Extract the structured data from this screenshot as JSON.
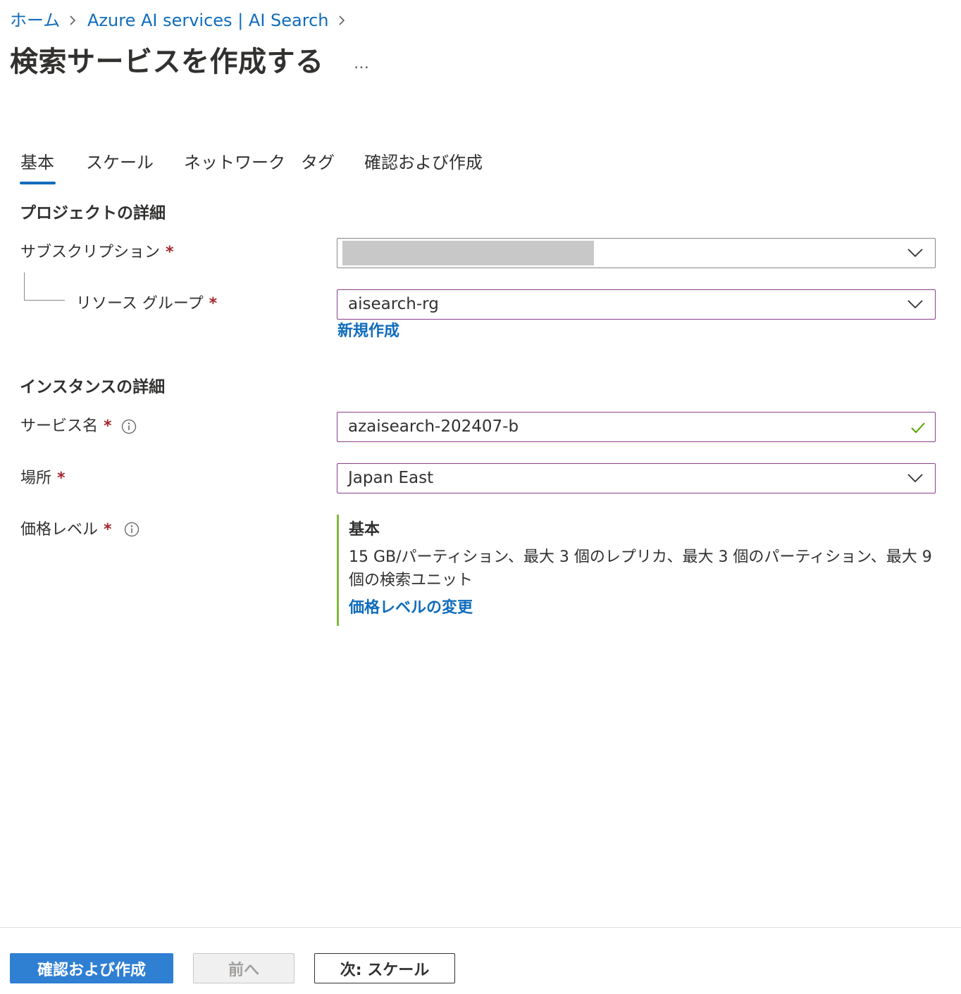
{
  "breadcrumb": {
    "home": "ホーム",
    "service": "Azure AI services | AI Search"
  },
  "page": {
    "title": "検索サービスを作成する",
    "more": "…"
  },
  "tabs": [
    {
      "label": "基本",
      "active": true
    },
    {
      "label": "スケール"
    },
    {
      "label": "ネットワーク"
    },
    {
      "label": "タグ"
    },
    {
      "label": "確認および作成"
    }
  ],
  "project": {
    "heading": "プロジェクトの詳細",
    "subscription_label": "サブスクリプション",
    "resource_group_label": "リソース グループ",
    "resource_group_value": "aisearch-rg",
    "create_new": "新規作成"
  },
  "instance": {
    "heading": "インスタンスの詳細",
    "service_name_label": "サービス名",
    "service_name_value": "azaisearch-202407-b",
    "location_label": "場所",
    "location_value": "Japan East",
    "pricing_label": "価格レベル",
    "pricing_tier": "基本",
    "pricing_description": "15 GB/パーティション、最大 3 個のレプリカ、最大 3 個のパーティション、最大 9 個の検索ユニット",
    "pricing_change": "価格レベルの変更"
  },
  "required_marker": "*",
  "footer": {
    "review_create": "確認および作成",
    "previous": "前へ",
    "next": "次: スケール"
  },
  "colors": {
    "link": "#0f6cbd",
    "primary_button": "#2f7fd3",
    "required": "#a4262c",
    "pricing_accent": "#7fba3a",
    "valid_check": "#57a300",
    "focus_border": "#8a3f8f"
  }
}
